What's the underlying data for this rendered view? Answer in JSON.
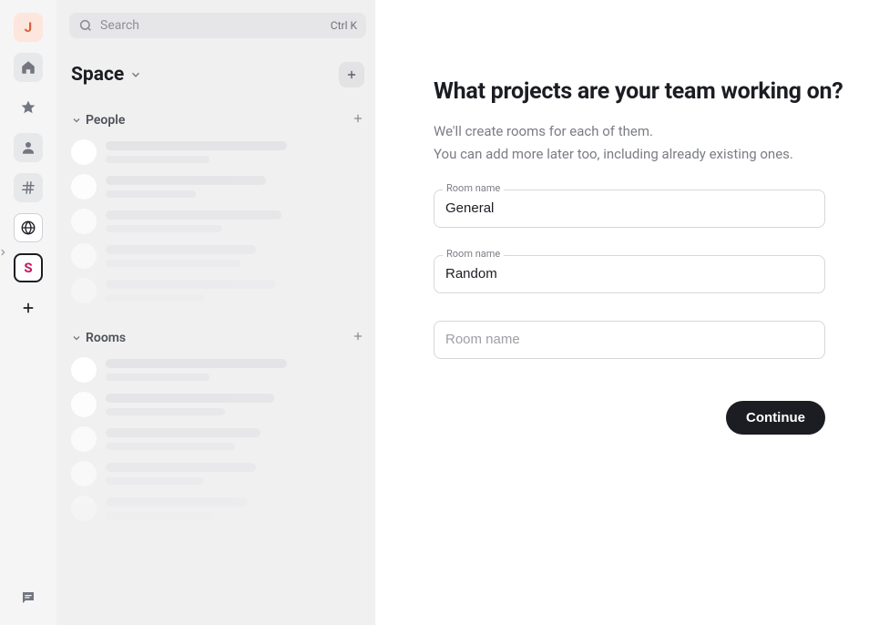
{
  "rail": {
    "avatar_letter": "J",
    "space_letter": "S"
  },
  "sidebar": {
    "search_placeholder": "Search",
    "search_shortcut": "Ctrl K",
    "space_title": "Space",
    "groups": {
      "people": "People",
      "rooms": "Rooms"
    }
  },
  "main": {
    "heading": "What projects are your team working on?",
    "sub1": "We'll create rooms for each of them.",
    "sub2": "You can add more later too, including already existing ones.",
    "field_label": "Room name",
    "room_placeholder": "Room name",
    "room1_value": "General",
    "room2_value": "Random",
    "continue_label": "Continue"
  }
}
